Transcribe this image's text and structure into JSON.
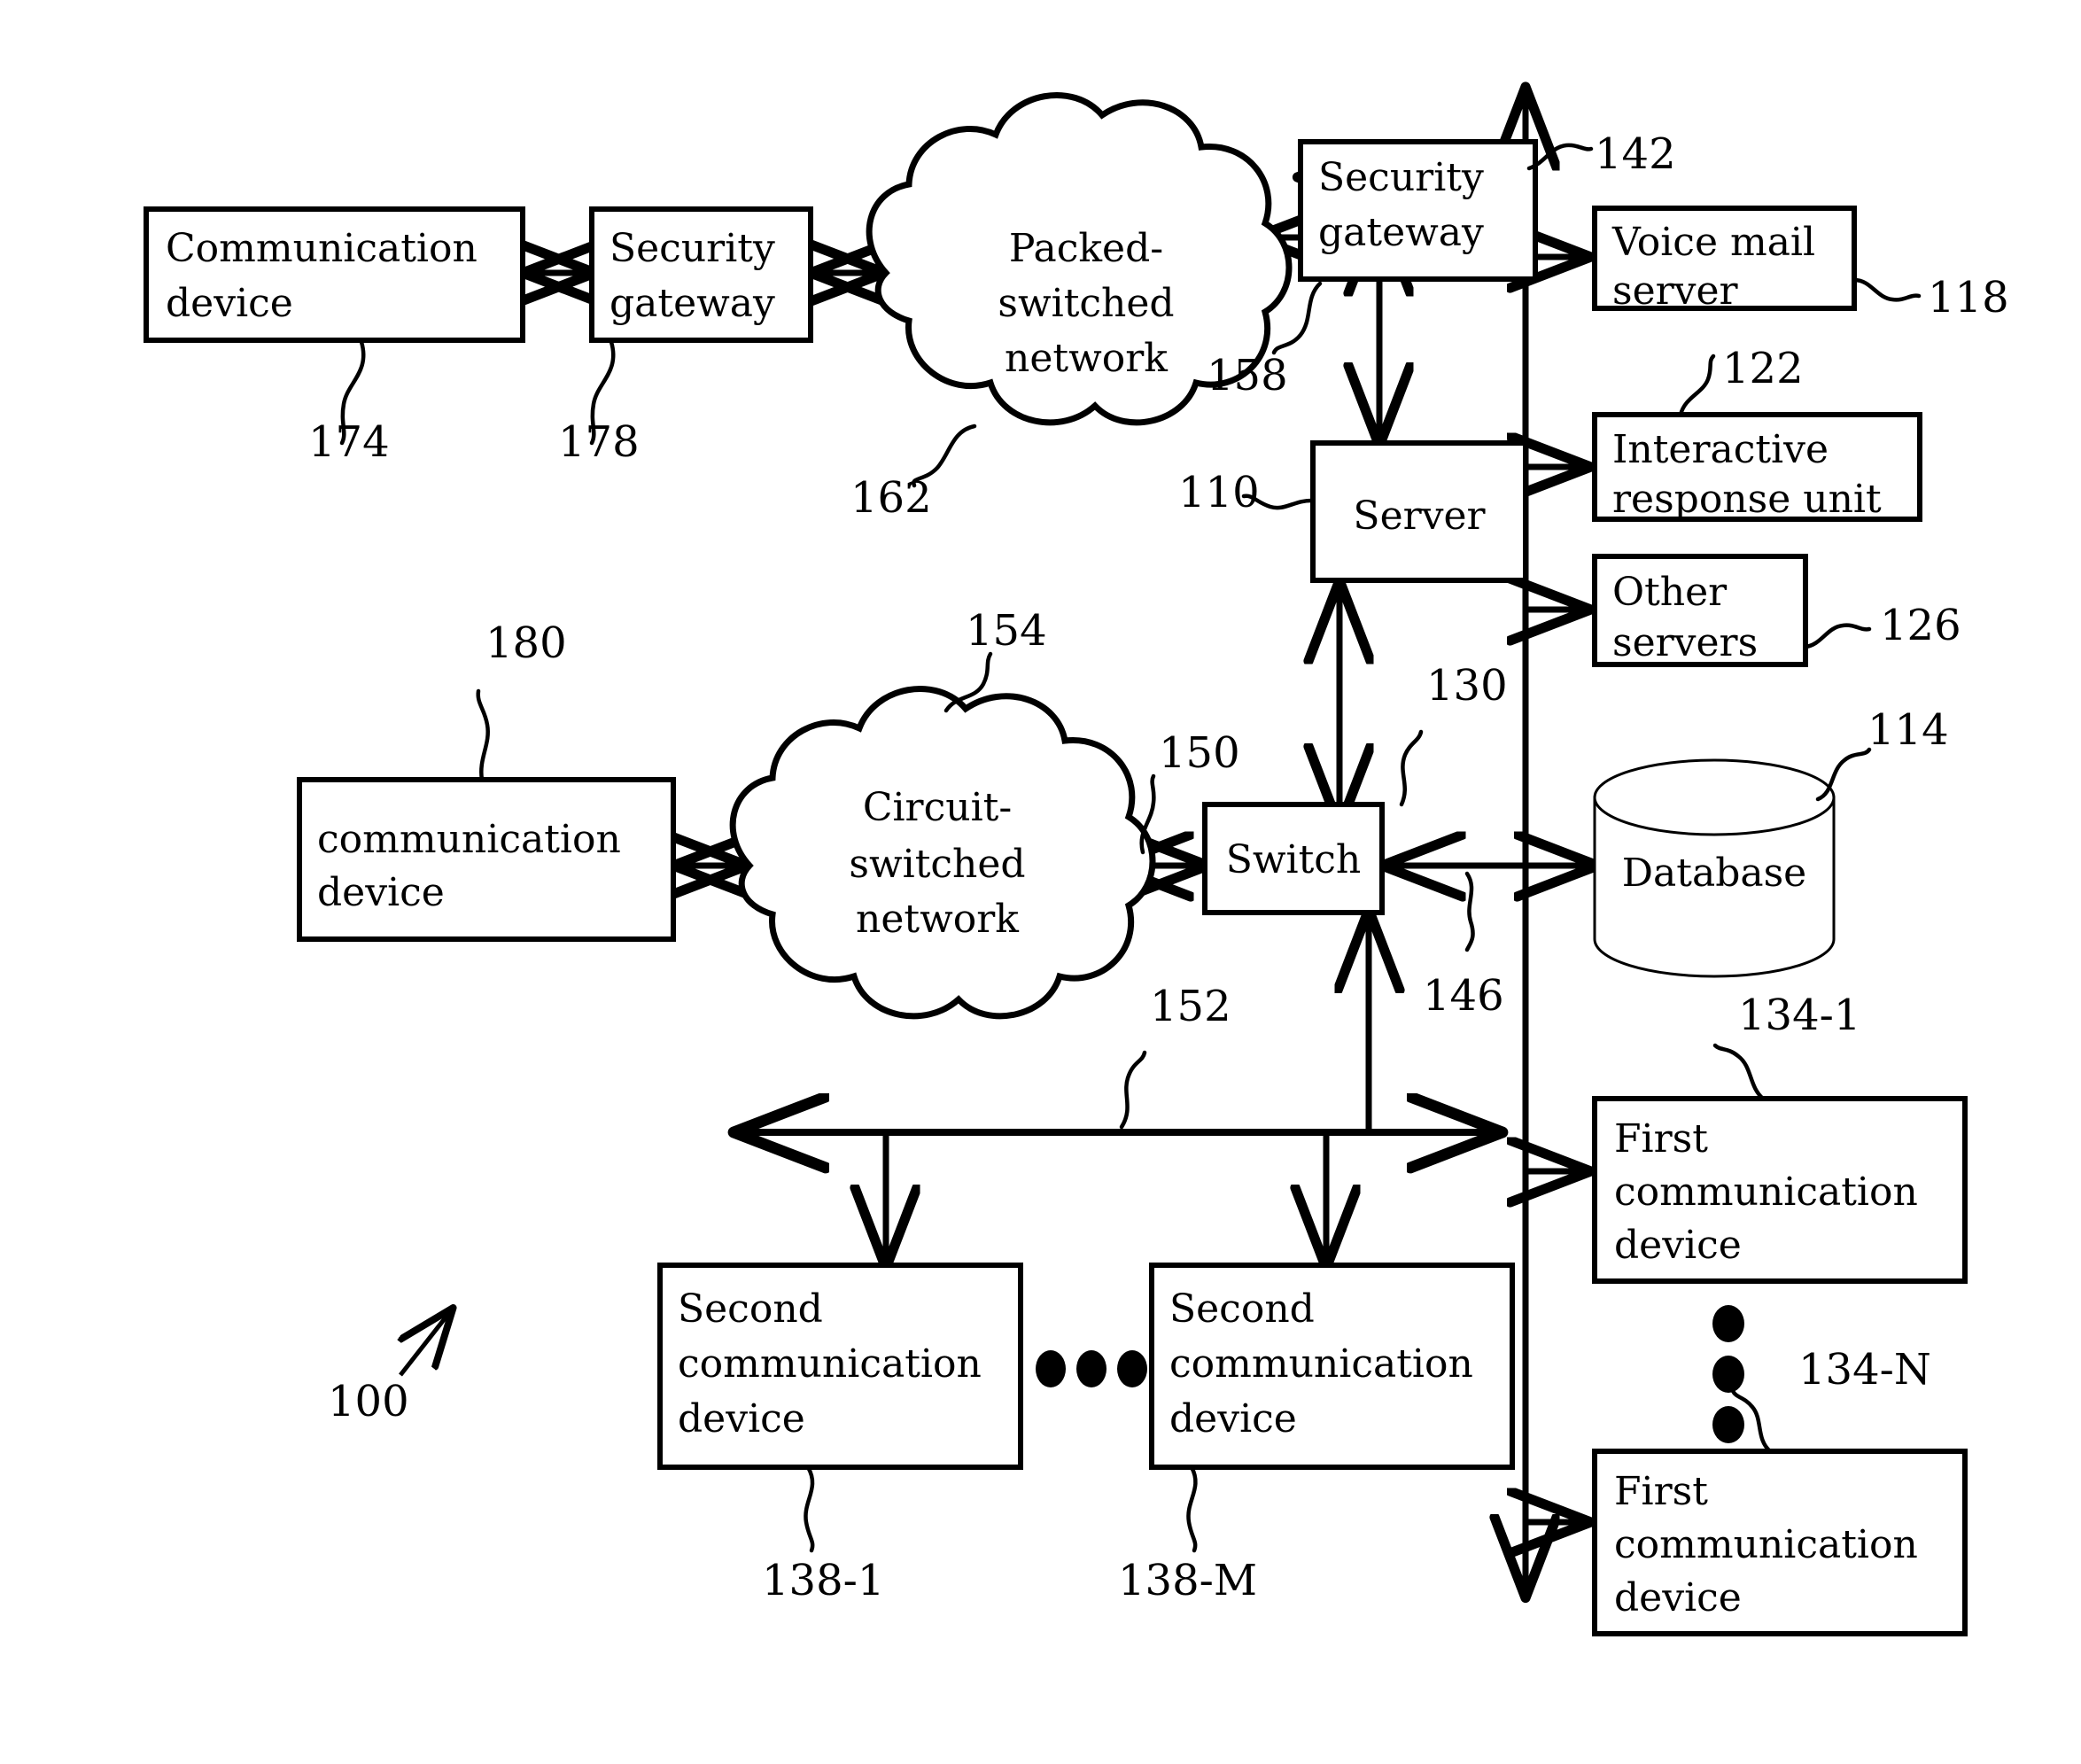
{
  "figure": {
    "reference_numeral": "100",
    "nodes": [
      {
        "id": "comm_device_174",
        "label_lines": [
          "Communication",
          "device"
        ],
        "ref": "174"
      },
      {
        "id": "security_gateway_178",
        "label_lines": [
          "Security",
          "gateway"
        ],
        "ref": "178"
      },
      {
        "id": "packet_network_162",
        "label_lines": [
          "Packed-",
          "switched",
          "network"
        ],
        "ref": "162"
      },
      {
        "id": "security_gateway_158",
        "label_lines": [
          "Security",
          "gateway"
        ],
        "ref": "158"
      },
      {
        "id": "server_110",
        "label_lines": [
          "Server"
        ],
        "ref": "110"
      },
      {
        "id": "voice_mail_server_118",
        "label_lines": [
          "Voice mail",
          "server"
        ],
        "ref": "118"
      },
      {
        "id": "interactive_response_unit_122",
        "label_lines": [
          "Interactive",
          "response unit"
        ],
        "ref": "122"
      },
      {
        "id": "other_servers_126",
        "label_lines": [
          "Other",
          "servers"
        ],
        "ref": "126"
      },
      {
        "id": "database_114",
        "label_lines": [
          "Database"
        ],
        "ref": "114"
      },
      {
        "id": "comm_device_180",
        "label_lines": [
          "communication",
          "device"
        ],
        "ref": "180"
      },
      {
        "id": "circuit_network_154",
        "label_lines": [
          "Circuit-",
          "switched",
          "network"
        ],
        "ref": "154"
      },
      {
        "id": "switch_130",
        "label_lines": [
          "Switch"
        ],
        "ref": "130"
      },
      {
        "id": "second_comm_device_138_1",
        "label_lines": [
          "Second",
          "communication",
          "device"
        ],
        "ref": "138-1"
      },
      {
        "id": "second_comm_device_138_M",
        "label_lines": [
          "Second",
          "communication",
          "device"
        ],
        "ref": "138-M"
      },
      {
        "id": "first_comm_device_134_1",
        "label_lines": [
          "First",
          "communication",
          "device"
        ],
        "ref": "134-1"
      },
      {
        "id": "first_comm_device_134_N",
        "label_lines": [
          "First",
          "communication",
          "device"
        ],
        "ref": "134-N"
      }
    ],
    "link_refs": [
      {
        "id": "bus_142",
        "ref": "142"
      },
      {
        "id": "switch_db_link_146",
        "ref": "146"
      },
      {
        "id": "switch_csn_link_150",
        "ref": "150"
      },
      {
        "id": "lan_bus_152",
        "ref": "152"
      }
    ],
    "labels": {
      "comm_device_174_line1": "Communication",
      "comm_device_174_line2": "device",
      "security_gateway_178_line1": "Security",
      "security_gateway_178_line2": "gateway",
      "packet_network_line1": "Packed-",
      "packet_network_line2": "switched",
      "packet_network_line3": "network",
      "security_gateway_158_line1": "Security",
      "security_gateway_158_line2": "gateway",
      "server_110": "Server",
      "voice_mail_line1": "Voice mail",
      "voice_mail_line2": "server",
      "iru_line1": "Interactive",
      "iru_line2": "response unit",
      "other_servers_line1": "Other",
      "other_servers_line2": "servers",
      "database": "Database",
      "comm_device_180_line1": "communication",
      "comm_device_180_line2": "device",
      "circuit_network_line1": "Circuit-",
      "circuit_network_line2": "switched",
      "circuit_network_line3": "network",
      "switch": "Switch",
      "second_comm_1_line1": "Second",
      "second_comm_1_line2": "communication",
      "second_comm_1_line3": "device",
      "second_comm_m_line1": "Second",
      "second_comm_m_line2": "communication",
      "second_comm_m_line3": "device",
      "first_comm_1_line1": "First",
      "first_comm_1_line2": "communication",
      "first_comm_1_line3": "device",
      "first_comm_n_line1": "First",
      "first_comm_n_line2": "communication",
      "first_comm_n_line3": "device"
    },
    "refs": {
      "r100": "100",
      "r110": "110",
      "r114": "114",
      "r118": "118",
      "r122": "122",
      "r126": "126",
      "r130": "130",
      "r134_1": "134-1",
      "r134_N": "134-N",
      "r138_1": "138-1",
      "r138_M": "138-M",
      "r142": "142",
      "r146": "146",
      "r150": "150",
      "r152": "152",
      "r154": "154",
      "r158": "158",
      "r162": "162",
      "r174": "174",
      "r178": "178",
      "r180": "180"
    },
    "colors": {
      "stroke": "#000000",
      "background": "#ffffff"
    }
  }
}
